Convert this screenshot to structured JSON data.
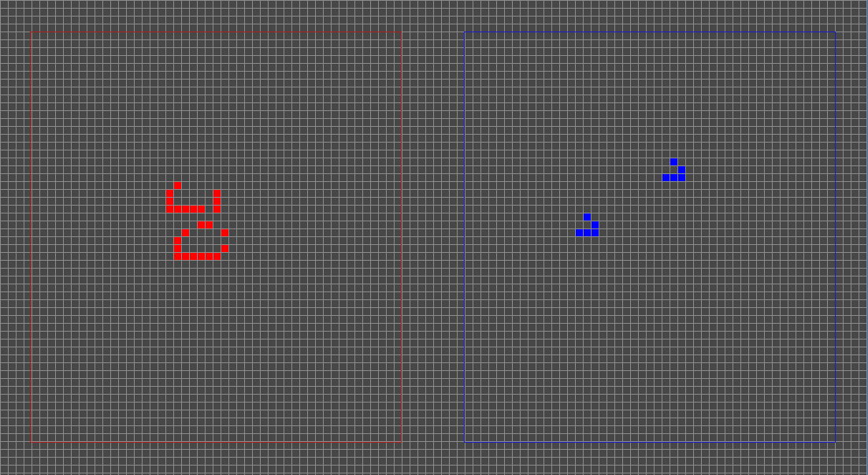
{
  "board": {
    "grid_cell": 10,
    "background": "#474747",
    "grid_line_color": "#8c8c8c"
  },
  "players": [
    {
      "name": "red",
      "color": "#ff0000",
      "zone_color": "#b01e1e",
      "cells": [
        [
          22,
          23
        ],
        [
          21,
          24
        ],
        [
          27,
          24
        ],
        [
          21,
          25
        ],
        [
          27,
          25
        ],
        [
          21,
          26
        ],
        [
          22,
          26
        ],
        [
          23,
          26
        ],
        [
          24,
          26
        ],
        [
          25,
          26
        ],
        [
          27,
          26
        ],
        [
          25,
          28
        ],
        [
          26,
          28
        ],
        [
          23,
          29
        ],
        [
          28,
          29
        ],
        [
          22,
          30
        ],
        [
          22,
          31
        ],
        [
          28,
          31
        ],
        [
          22,
          32
        ],
        [
          23,
          32
        ],
        [
          24,
          32
        ],
        [
          25,
          32
        ],
        [
          26,
          32
        ],
        [
          27,
          32
        ]
      ]
    },
    {
      "name": "blue",
      "color": "#0000ff",
      "zone_color": "#1a1ad0",
      "cells": [
        [
          85,
          20
        ],
        [
          86,
          21
        ],
        [
          84,
          22
        ],
        [
          85,
          22
        ],
        [
          86,
          22
        ],
        [
          74,
          27
        ],
        [
          75,
          28
        ],
        [
          73,
          29
        ],
        [
          74,
          29
        ],
        [
          75,
          29
        ]
      ]
    }
  ]
}
